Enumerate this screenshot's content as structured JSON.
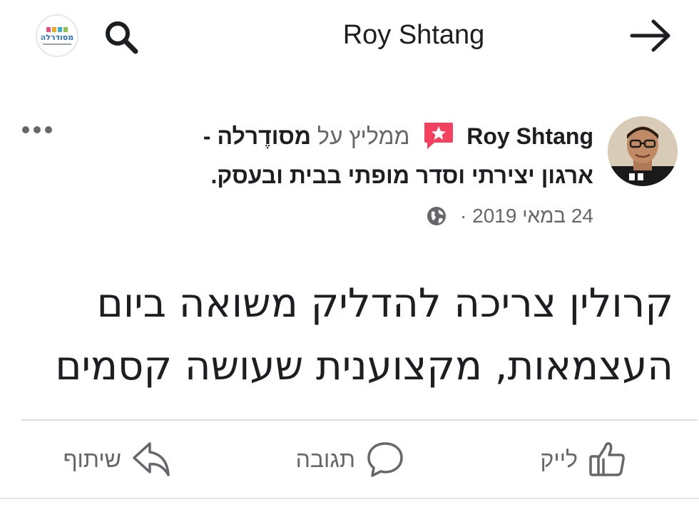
{
  "topbar": {
    "title": "Roy Shtang",
    "logo_text": "מסודרלה",
    "icons": {
      "search": "search-icon",
      "back": "arrow-right-icon"
    }
  },
  "post": {
    "author": "Roy Shtang",
    "recommends_text": "ממליץ על",
    "page_name_line1": "מסודֶרלה -",
    "page_name_line2": "ארגון יצירתי וסדר מופתי בבית ובעסק",
    "period": ".",
    "date": "24 במאי 2019",
    "separator": "·",
    "body_line1": "קרולין צריכה להדליק משואה ביום",
    "body_line2": "העצמאות, מקצוענית שעושה קסמים",
    "icons": {
      "recommend": "recommend-star-icon",
      "privacy": "globe-icon",
      "more": "more-options-icon"
    }
  },
  "actions": {
    "like": "לייק",
    "comment": "תגובה",
    "share": "שיתוף"
  },
  "colors": {
    "text_primary": "#1c1e21",
    "text_secondary": "#65676b",
    "recommend_badge": "#f3425f",
    "divider": "#dadde1"
  }
}
